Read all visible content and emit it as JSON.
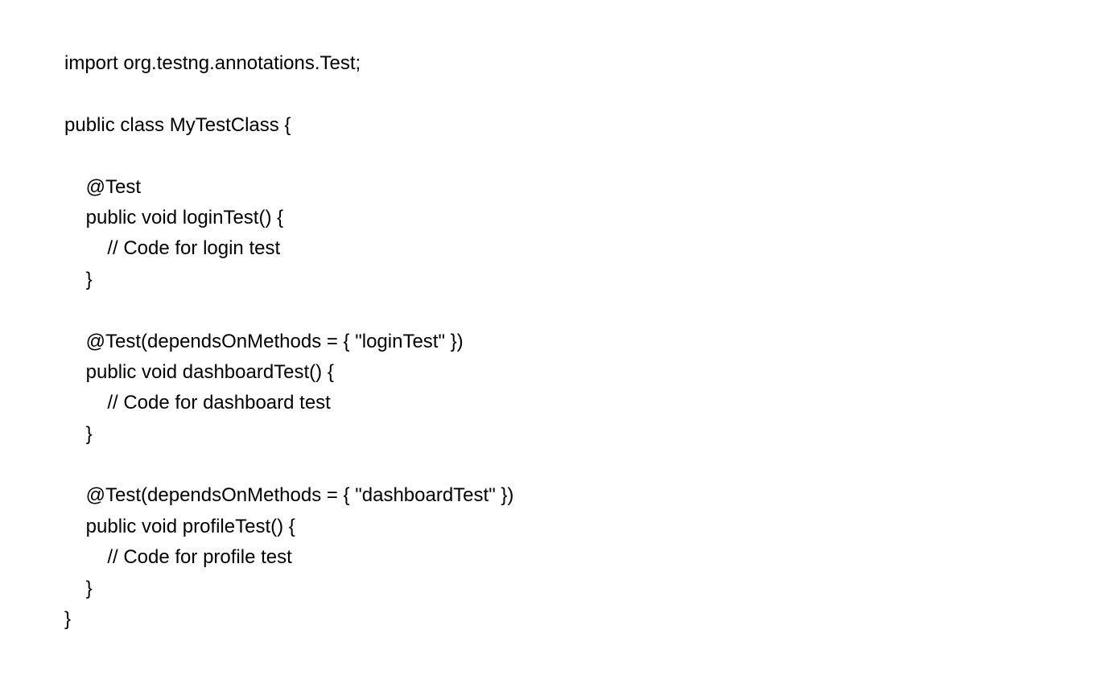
{
  "code": {
    "line1": "import org.testng.annotations.Test;",
    "line2": "",
    "line3": "public class MyTestClass {",
    "line4": "",
    "line5": "    @Test",
    "line6": "    public void loginTest() {",
    "line7": "        // Code for login test",
    "line8": "    }",
    "line9": "",
    "line10": "    @Test(dependsOnMethods = { \"loginTest\" })",
    "line11": "    public void dashboardTest() {",
    "line12": "        // Code for dashboard test",
    "line13": "    }",
    "line14": "",
    "line15": "    @Test(dependsOnMethods = { \"dashboardTest\" })",
    "line16": "    public void profileTest() {",
    "line17": "        // Code for profile test",
    "line18": "    }",
    "line19": "}"
  }
}
